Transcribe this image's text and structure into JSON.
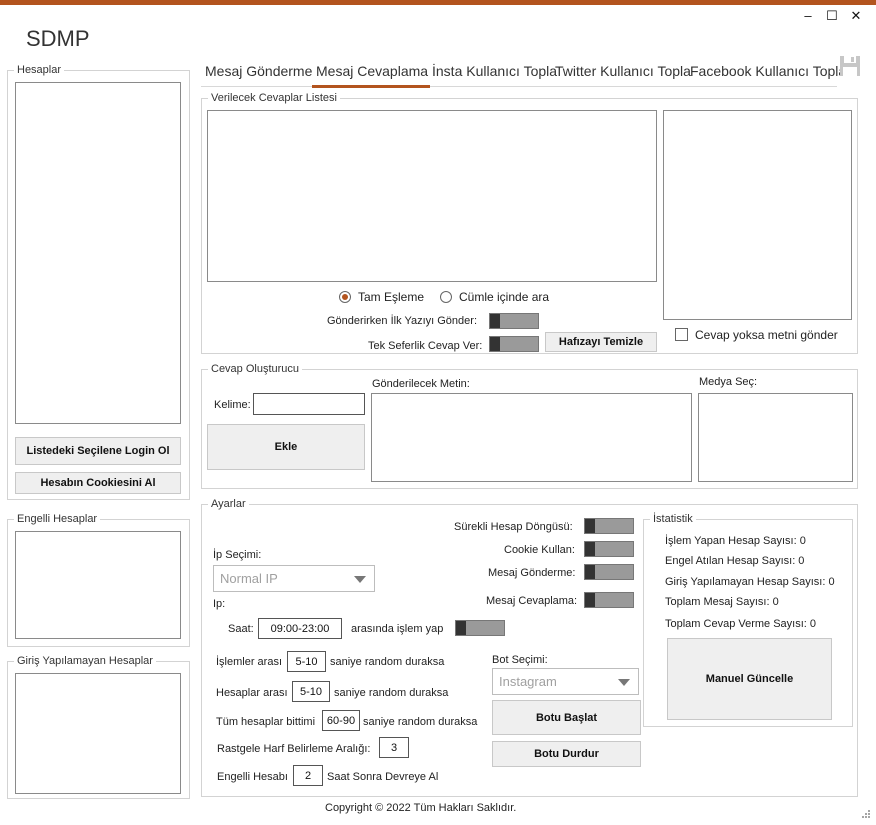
{
  "app": {
    "title": "SDMP"
  },
  "window": {
    "minimize": "–",
    "maximize": "☐",
    "close": "✕"
  },
  "colors": {
    "accent": "#b3541e"
  },
  "icons": {
    "save": "save-icon"
  },
  "tabs": [
    {
      "label": "Mesaj Gönderme"
    },
    {
      "label": "Mesaj Cevaplama"
    },
    {
      "label": "İnsta Kullanıcı Topla"
    },
    {
      "label": "Twitter Kullanıcı Topla"
    },
    {
      "label": "Facebook Kullanıcı Topla"
    }
  ],
  "active_tab": "Mesaj Cevaplama",
  "sidebar": {
    "accounts_title": "Hesaplar",
    "login_selected_button": "Listedeki Seçilene Login Ol",
    "get_cookies_button": "Hesabın Cookiesini Al",
    "blocked_title": "Engelli Hesaplar",
    "failed_login_title": "Giriş Yapılamayan Hesaplar"
  },
  "replies": {
    "title": "Verilecek Cevaplar Listesi",
    "match_exact": "Tam Eşleme",
    "match_contains": "Cümle içinde ara",
    "send_first_text_label": "Gönderirken İlk Yazıyı Gönder:",
    "reply_once_label": "Tek Seferlik Cevap Ver:",
    "clear_memory_button": "Hafızayı Temizle",
    "send_if_no_reply_label": "Cevap yoksa metni gönder"
  },
  "builder": {
    "title": "Cevap Oluşturucu",
    "keyword_label": "Kelime:",
    "keyword_value": "",
    "text_label": "Gönderilecek Metin:",
    "media_label": "Medya Seç:",
    "add_button": "Ekle"
  },
  "settings": {
    "title": "Ayarlar",
    "loop_label": "Sürekli Hesap Döngüsü:",
    "cookie_label": "Cookie Kullan:",
    "send_msg_label": "Mesaj Gönderme:",
    "reply_msg_label": "Mesaj Cevaplama:",
    "ip_select_label": "İp Seçimi:",
    "ip_select_value": "Normal IP",
    "ip_label": "Ip:",
    "time_label": "Saat:",
    "time_value": "09:00-23:00",
    "time_suffix": "arasında işlem yap",
    "between_ops_label": "İşlemler arası",
    "between_ops_value": "5-10",
    "between_ops_suffix": "saniye random duraksa",
    "between_accounts_label": "Hesaplar arası",
    "between_accounts_value": "5-10",
    "between_accounts_suffix": "saniye random duraksa",
    "all_done_label": "Tüm hesaplar bittimi",
    "all_done_value": "60-90",
    "all_done_suffix": "saniye random duraksa",
    "random_letter_label": "Rastgele Harf Belirleme Aralığı:",
    "random_letter_value": "3",
    "blocked_label": "Engelli Hesabı",
    "blocked_value": "2",
    "blocked_suffix": "Saat Sonra Devreye Al",
    "bot_select_label": "Bot Seçimi:",
    "bot_select_value": "Instagram",
    "start_bot_button": "Botu Başlat",
    "stop_bot_button": "Botu Durdur"
  },
  "stats": {
    "title": "İstatistik",
    "active_accounts": "İşlem Yapan Hesap Sayısı: 0",
    "blocked_accounts": "Engel Atılan Hesap Sayısı: 0",
    "failed_accounts": "Giriş Yapılamayan Hesap Sayısı: 0",
    "total_messages": "Toplam Mesaj Sayısı: 0",
    "total_replies": "Toplam Cevap Verme Sayısı: 0",
    "manual_update_button": "Manuel Güncelle"
  },
  "footer": {
    "copyright": "Copyright © 2022 Tüm Hakları Saklıdır."
  }
}
